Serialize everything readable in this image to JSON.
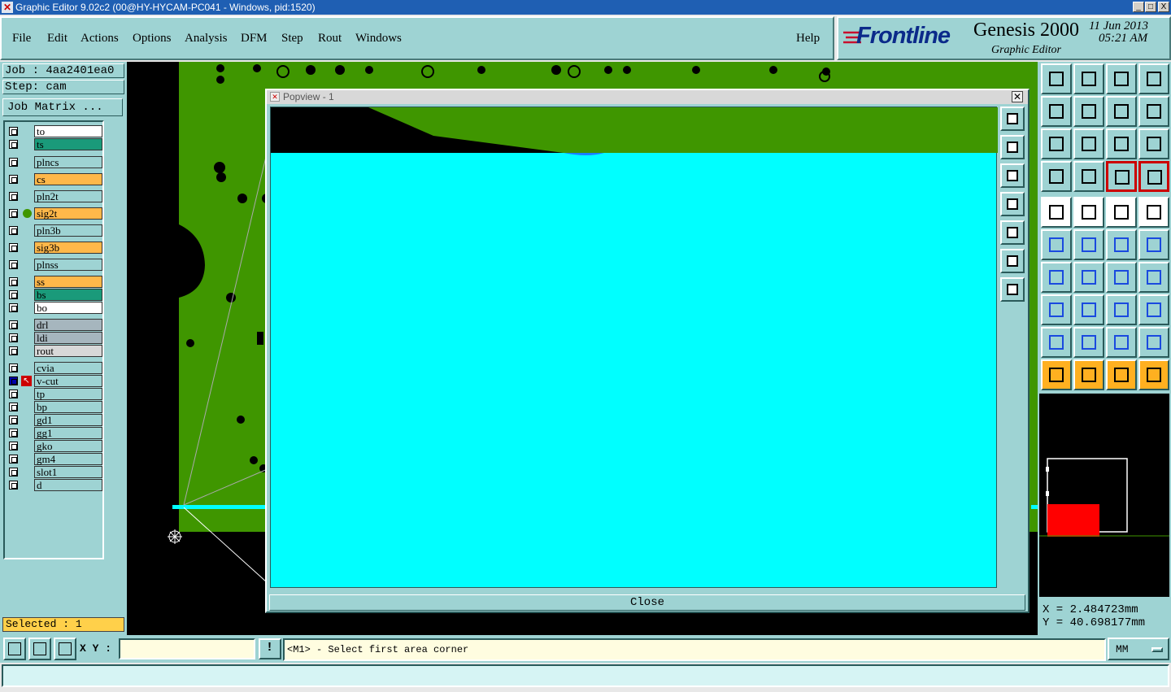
{
  "titlebar": {
    "title": "Graphic Editor 9.02c2 (00@HY-HYCAM-PC041 - Windows, pid:1520)",
    "min": "_",
    "max": "□",
    "close": "X"
  },
  "menu": {
    "file": "File",
    "edit": "Edit",
    "actions": "Actions",
    "options": "Options",
    "analysis": "Analysis",
    "dfm": "DFM",
    "step": "Step",
    "rout": "Rout",
    "windows": "Windows",
    "help": "Help"
  },
  "brand": {
    "logo": "Frontline",
    "product": "Genesis 2000",
    "date": "11 Jun 2013",
    "time": "05:21 AM",
    "subtitle": "Graphic Editor",
    "accent": "#c8102e"
  },
  "job": {
    "job": "Job : 4aa2401ea0",
    "step": "Step: cam",
    "matrix_button": "Job Matrix ..."
  },
  "layers": [
    {
      "name": "to",
      "color": "#ffffff"
    },
    {
      "name": "ts",
      "color": "#1a9a7a"
    },
    {
      "name": "plncs",
      "color": "#9ed3d3"
    },
    {
      "name": "cs",
      "color": "#ffb84a"
    },
    {
      "name": "pln2t",
      "color": "#9ed3d3"
    },
    {
      "name": "sig2t",
      "color": "#ffb84a"
    },
    {
      "name": "pln3b",
      "color": "#9ed3d3"
    },
    {
      "name": "sig3b",
      "color": "#ffb84a"
    },
    {
      "name": "plnss",
      "color": "#9ed3d3"
    },
    {
      "name": "ss",
      "color": "#ffb84a"
    },
    {
      "name": "bs",
      "color": "#1a9a7a"
    },
    {
      "name": "bo",
      "color": "#ffffff"
    },
    {
      "name": "drl",
      "color": "#a6b6be"
    },
    {
      "name": "ldi",
      "color": "#a6b6be"
    },
    {
      "name": "rout",
      "color": "#d8d8d8"
    },
    {
      "name": "cvia",
      "color": "#9ed3d3"
    },
    {
      "name": "v-cut",
      "color": "#9ed3d3"
    },
    {
      "name": "tp",
      "color": "#9ed3d3"
    },
    {
      "name": "bp",
      "color": "#9ed3d3"
    },
    {
      "name": "gd1",
      "color": "#9ed3d3"
    },
    {
      "name": "gg1",
      "color": "#9ed3d3"
    },
    {
      "name": "gko",
      "color": "#9ed3d3"
    },
    {
      "name": "gm4",
      "color": "#9ed3d3"
    },
    {
      "name": "slot1",
      "color": "#9ed3d3"
    },
    {
      "name": "d",
      "color": "#9ed3d3"
    }
  ],
  "selected": "Selected : 1",
  "popview": {
    "title": "Popview - 1",
    "close_label": "Close"
  },
  "coords": {
    "x": "X = 2.484723mm",
    "y": "Y = 40.698177mm"
  },
  "bottom": {
    "xy_label": "X Y :",
    "xy_value": "",
    "prompt": "<M1> - Select first area corner",
    "units": "MM"
  },
  "colors": {
    "board_green": "#3f9600",
    "cyan": "#00ffff",
    "panel": "#9ed3d3"
  }
}
